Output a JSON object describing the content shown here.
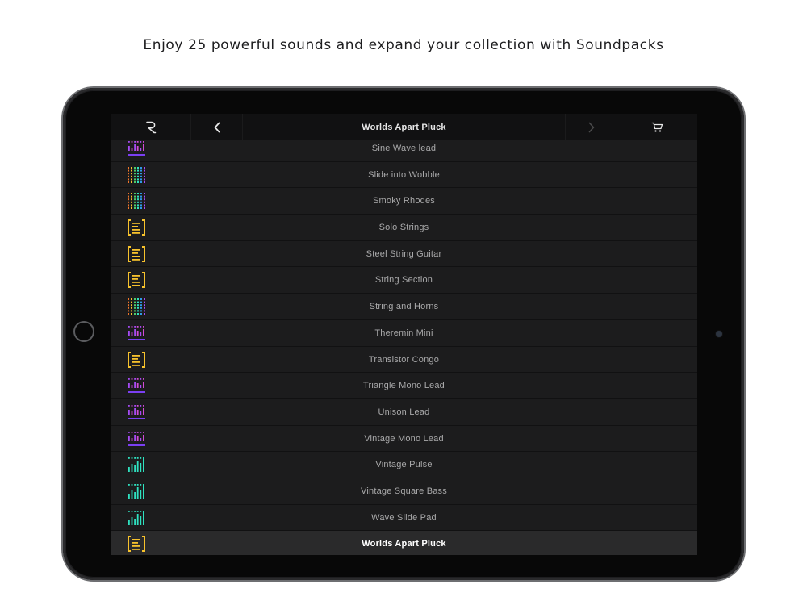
{
  "tagline": "Enjoy 25 powerful sounds and expand your collection with Soundpacks",
  "topbar": {
    "logo_icon": "r-logo-icon",
    "back_icon": "chevron-left-icon",
    "title": "Worlds Apart Pluck",
    "forward_icon": "chevron-right-icon",
    "cart_icon": "cart-icon"
  },
  "colors": {
    "purple": "#a64bf4",
    "purple_bar": "#7b3ff2",
    "magenta": "#d14bd6",
    "teal": "#2fe2c0",
    "yellow": "#f7c22c",
    "orange": "#f0772a",
    "green": "#4ccb6a",
    "blue": "#2f9ae8"
  },
  "sounds": [
    {
      "name": "Sine Wave lead",
      "icon": "purple-bars-icon"
    },
    {
      "name": "Slide into Wobble",
      "icon": "multicolor-dots-icon"
    },
    {
      "name": "Smoky Rhodes",
      "icon": "multicolor-dots-icon"
    },
    {
      "name": "Solo Strings",
      "icon": "yellow-bracket-icon"
    },
    {
      "name": "Steel String Guitar",
      "icon": "yellow-bracket-icon"
    },
    {
      "name": "String Section",
      "icon": "yellow-bracket-icon"
    },
    {
      "name": "String and Horns",
      "icon": "multicolor-dots-icon"
    },
    {
      "name": "Theremin Mini",
      "icon": "purple-bars-icon"
    },
    {
      "name": "Transistor Congo",
      "icon": "yellow-bracket-icon"
    },
    {
      "name": "Triangle Mono Lead",
      "icon": "purple-bars-icon"
    },
    {
      "name": "Unison Lead",
      "icon": "purple-bars-icon"
    },
    {
      "name": "Vintage Mono Lead",
      "icon": "purple-bars-icon"
    },
    {
      "name": "Vintage Pulse",
      "icon": "teal-bars-icon"
    },
    {
      "name": "Vintage Square Bass",
      "icon": "teal-bars-icon"
    },
    {
      "name": "Wave Slide Pad",
      "icon": "teal-bars-icon"
    },
    {
      "name": "Worlds Apart Pluck",
      "icon": "yellow-bracket-icon",
      "selected": true
    }
  ]
}
